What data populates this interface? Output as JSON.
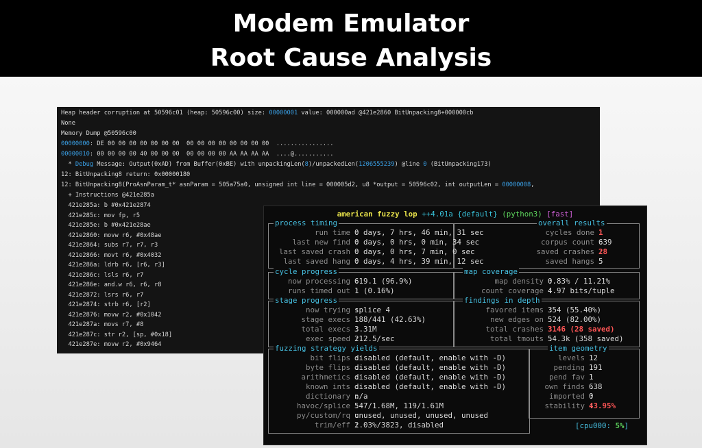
{
  "slide": {
    "title_line1": "Modem Emulator",
    "title_line2": "Root Cause Analysis"
  },
  "debug": {
    "l1": {
      "a": "Heap header corruption at 50596c01 (heap: 50596c00) size: ",
      "b": "00000001",
      "c": " value: 000000ad @421e2860 BitUnpacking8+000000cb"
    },
    "l2": "None",
    "l3": "Memory Dump @50596c00",
    "l4": {
      "a": "00000000",
      "b": ": DE 00 00 00 00 00 00 00  00 00 00 00 00 00 00 00  ................"
    },
    "l5": {
      "a": "00000010",
      "b": ": 00 00 00 00 40 00 00 00  00 00 00 00 AA AA AA AA  ....@..........."
    },
    "l6": {
      "a": "  * ",
      "b": "Debug",
      "c": " Message: Output(0xAD) from Buffer(0xBE) with unpackingLen(",
      "d": "8",
      "e": ")/unpackedLen(",
      "f": "1206555239",
      "g": ") @line ",
      "h": "0",
      "i": " (BitUnpacking173)"
    },
    "l7": "12: BitUnpacking8 return: 0x00000180",
    "l8": {
      "a": "12: BitUnpacking8(ProAsnParam_t* asnParam = 505a75a0, unsigned int line = 000005d2, u8 *output = 50596c02, int outputLen = ",
      "b": "00000008",
      "c": ","
    },
    "l9": "  + Instructions @421e285a",
    "instr": [
      "  421e285a: b #0x421e2874",
      "  421e285c: mov fp, r5",
      "  421e285e: b #0x421e28ae",
      "  421e2860: movw r6, #0x48ae",
      "  421e2864: subs r7, r7, r3",
      "  421e2866: movt r6, #0x4032",
      "  421e286a: ldrb r6, [r6, r3]",
      "  421e286c: lsls r6, r7",
      "  421e286e: and.w r6, r6, r8",
      "  421e2872: lsrs r6, r7",
      "  421e2874: strb r6, [r2]",
      "  421e2876: movw r2, #0x1042",
      "  421e287a: movs r7, #8",
      "  421e287c: str r2, [sp, #0x18]",
      "  421e287e: movw r2, #0x9464"
    ]
  },
  "afl": {
    "title": {
      "name": "american fuzzy lop",
      "version": "++4.01a",
      "mode": "{default}",
      "target": "(python3)",
      "speed": "[fast]"
    },
    "process_timing": {
      "heading": "process timing",
      "labels": [
        "run time",
        "last new find",
        "last saved crash",
        "last saved hang"
      ],
      "values": [
        "0 days, 7 hrs, 46 min, 31 sec",
        "0 days, 0 hrs, 0 min, 34 sec",
        "0 days, 0 hrs, 7 min, 0 sec",
        "0 days, 4 hrs, 39 min, 12 sec"
      ]
    },
    "overall_results": {
      "heading": "overall results",
      "labels": [
        "cycles done",
        "corpus count",
        "saved crashes",
        "saved hangs"
      ],
      "values": [
        "1",
        "639",
        "28",
        "5"
      ]
    },
    "cycle_progress": {
      "heading": "cycle progress",
      "labels": [
        "now processing",
        "runs timed out"
      ],
      "values": [
        "619.1 (96.9%)",
        "1 (0.16%)"
      ]
    },
    "map_coverage": {
      "heading": "map coverage",
      "labels": [
        "map density",
        "count coverage"
      ],
      "values": [
        "0.83% / 11.21%",
        "4.97 bits/tuple"
      ]
    },
    "stage_progress": {
      "heading": "stage progress",
      "labels": [
        "now trying",
        "stage execs",
        "total execs",
        "exec speed"
      ],
      "values": [
        "splice 4",
        "188/441 (42.63%)",
        "3.31M",
        "212.5/sec"
      ]
    },
    "findings": {
      "heading": "findings in depth",
      "labels": [
        "favored items",
        "new edges on",
        "total crashes",
        "total tmouts"
      ],
      "values": [
        "354 (55.40%)",
        "524 (82.00%)",
        "3146 (28 saved)",
        "54.3k (358 saved)"
      ]
    },
    "fuzzing": {
      "heading": "fuzzing strategy yields",
      "labels": [
        "bit flips",
        "byte flips",
        "arithmetics",
        "known ints",
        "dictionary",
        "havoc/splice",
        "py/custom/rq",
        "trim/eff"
      ],
      "values": [
        "disabled (default, enable with -D)",
        "disabled (default, enable with -D)",
        "disabled (default, enable with -D)",
        "disabled (default, enable with -D)",
        "n/a",
        "547/1.68M, 119/1.61M",
        "unused, unused, unused, unused",
        "2.03%/3823, disabled"
      ]
    },
    "item_geometry": {
      "heading": "item geometry",
      "labels": [
        "levels",
        "pending",
        "pend fav",
        "own finds",
        "imported",
        "stability"
      ],
      "values": [
        "12",
        "191",
        "1",
        "638",
        "0",
        "43.95%"
      ]
    },
    "cpu": {
      "label": "[cpu000:",
      "value": "5%",
      "close": "]"
    },
    "sep": " : "
  },
  "colors": {
    "section": "#46bfe0",
    "label": "#8c8c8c",
    "alert": "#ff5555",
    "title": "#e6e04a"
  }
}
